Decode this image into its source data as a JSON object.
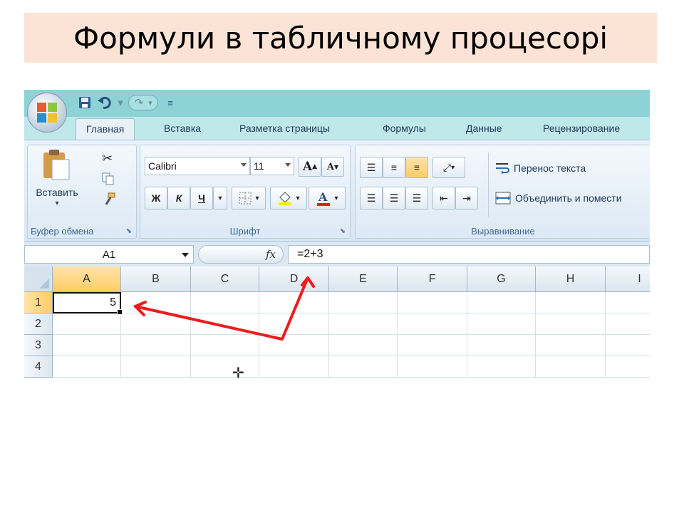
{
  "slide": {
    "title": "Формули в табличному процесорі"
  },
  "qat": {
    "save_icon": "save-icon",
    "undo_icon": "undo-icon",
    "redo_icon": "redo-icon",
    "customize_icon": "customize-qat-icon"
  },
  "tabs": [
    "Главная",
    "Вставка",
    "Разметка страницы",
    "Формулы",
    "Данные",
    "Рецензирование"
  ],
  "active_tab": "Главная",
  "clipboard": {
    "paste_label": "Вставить",
    "group_label": "Буфер обмена"
  },
  "font": {
    "family": "Calibri",
    "size": "11",
    "bold": "Ж",
    "italic": "К",
    "underline": "Ч",
    "grow": "A",
    "shrink": "A",
    "group_label": "Шрифт"
  },
  "alignment": {
    "wrap_text": "Перенос текста",
    "merge_center": "Объединить и помести",
    "group_label": "Выравнивание"
  },
  "formula_bar": {
    "name_box": "A1",
    "fx": "fx",
    "formula": "=2+3"
  },
  "grid": {
    "columns": [
      "A",
      "B",
      "C",
      "D",
      "E",
      "F",
      "G",
      "H",
      "I"
    ],
    "rows": [
      "1",
      "2",
      "3",
      "4"
    ],
    "selected_cell": "A1",
    "cells": {
      "A1": "5"
    }
  },
  "colors": {
    "title_band": "#fbe4d5",
    "ribbon_top": "#8dd3d6",
    "arrow": "#ee1c1c",
    "selected_header": "#ffcc66"
  }
}
